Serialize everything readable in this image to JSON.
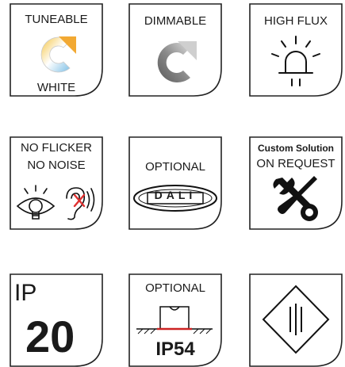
{
  "badges": {
    "tuneable": {
      "top": "TUNEABLE",
      "bottom": "WHITE"
    },
    "dimmable": {
      "label": "DIMMABLE"
    },
    "high_flux": {
      "label": "HIGH FLUX"
    },
    "no_flicker": {
      "line1": "NO FLICKER",
      "line2": "NO NOISE"
    },
    "dali": {
      "label": "OPTIONAL",
      "logo_text": "DALI"
    },
    "custom": {
      "line1": "Custom Solution",
      "line2": "ON REQUEST"
    },
    "ip20": {
      "prefix": "IP",
      "number": "20"
    },
    "ip54": {
      "label": "OPTIONAL",
      "rating": "IP54"
    },
    "class_symbol": {
      "icon": "class-insulation-icon"
    }
  },
  "colors": {
    "frame": "#222222",
    "refresh_dark": "#555555",
    "refresh_light": "#d0d0d0",
    "warm": "#f2b233",
    "cool": "#8fc8e8",
    "cross": "#e03030",
    "seal": "#cc2222"
  }
}
